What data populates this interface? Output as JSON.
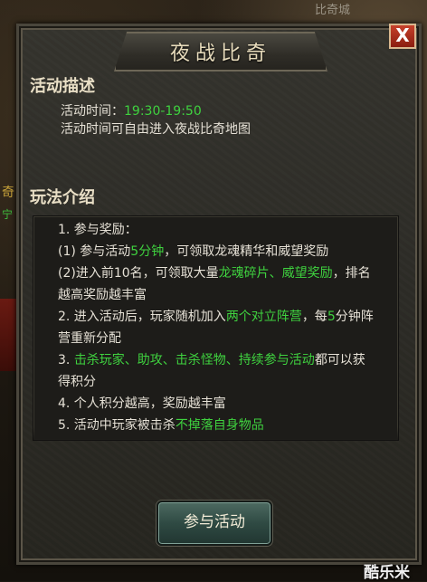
{
  "background": {
    "top_right_text": "比奇城",
    "left_glyph": "奇",
    "left_glyph2": "宁"
  },
  "window": {
    "title": "夜战比奇",
    "close_label": "X"
  },
  "description": {
    "heading": "活动描述",
    "time_label": "活动时间：",
    "time_value": "19:30-19:50",
    "note": "活动时间可自由进入夜战比奇地图"
  },
  "rules": {
    "heading": "玩法介绍",
    "line1": "1. 参与奖励：",
    "line2a": "(1) 参与活动",
    "line2b": "5分钟",
    "line2c": "，可领取龙魂精华和威望奖励",
    "line3a": "(2)进入前10名，可领取大量",
    "line3b": "龙魂碎片、威望奖励",
    "line3c": "，排名越高奖励越丰富",
    "line4a": "2. 进入活动后，玩家随机加入",
    "line4b": "两个对立阵营",
    "line4c": "，每",
    "line4d": "5",
    "line4e": "分钟阵营重新分配",
    "line5a": "3. ",
    "line5b": "击杀玩家、助攻、击杀怪物、持续参与活动",
    "line5c": "都可以获得积分",
    "line6": "4. 个人积分越高，奖励越丰富",
    "line7a": "5. 活动中玩家被击杀",
    "line7b": "不掉落自身物品"
  },
  "join_button": "参与活动",
  "watermark": "酷乐米",
  "colors": {
    "highlight_green": "#3fd23f",
    "close_red": "#b5321f"
  }
}
